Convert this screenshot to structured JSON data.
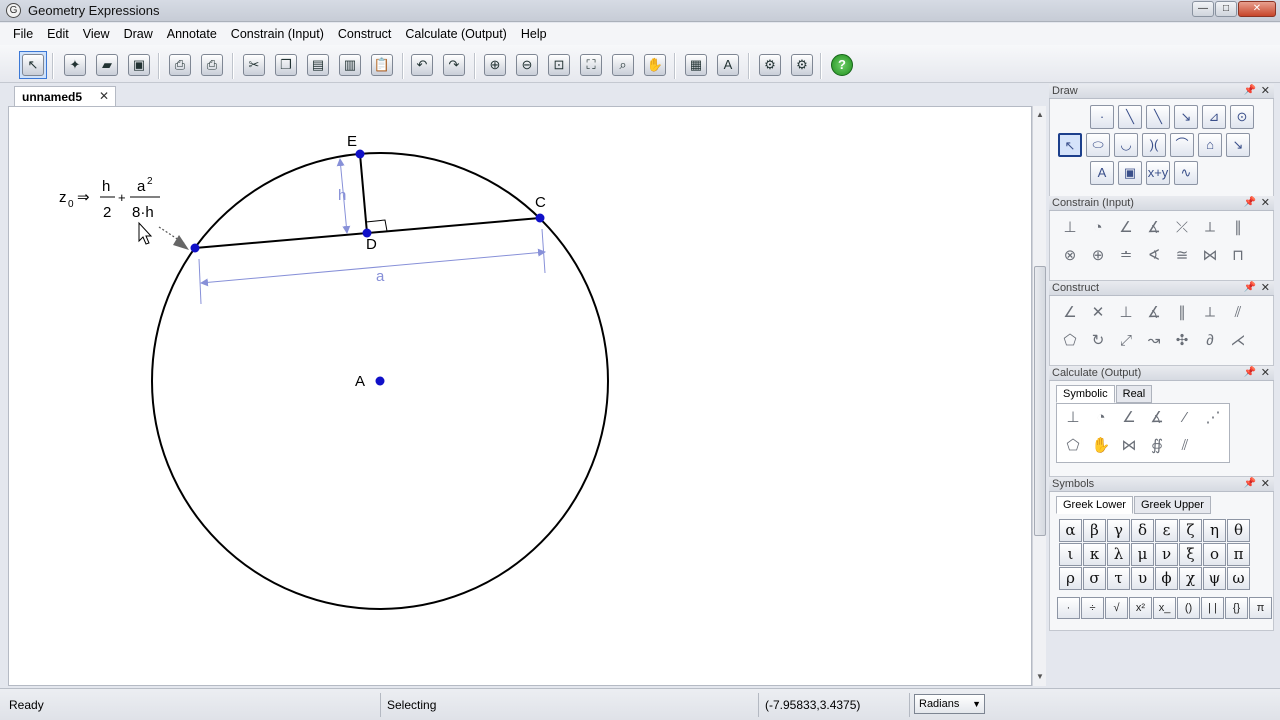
{
  "window": {
    "title": "Geometry Expressions",
    "min": "—",
    "max": "□",
    "close": "✕"
  },
  "menu": [
    "File",
    "Edit",
    "View",
    "Draw",
    "Annotate",
    "Constrain (Input)",
    "Construct",
    "Calculate (Output)",
    "Help"
  ],
  "document_tab": {
    "label": "unnamed5",
    "close": "✕"
  },
  "points": {
    "A": "A",
    "C": "C",
    "D": "D",
    "E": "E"
  },
  "dimensions": {
    "h": "h",
    "a": "a"
  },
  "formula": {
    "lhs": "z",
    "sub": "0",
    "arrow": "⇒",
    "num1": "h",
    "den1": "2",
    "plus": "+",
    "num2": "a",
    "sup": "2",
    "den2": "8·h"
  },
  "panels": {
    "draw": {
      "title": "Draw"
    },
    "constrain": {
      "title": "Constrain (Input)"
    },
    "construct": {
      "title": "Construct"
    },
    "calculate": {
      "title": "Calculate (Output)",
      "tabs": [
        "Symbolic",
        "Real"
      ]
    },
    "symbols": {
      "title": "Symbols",
      "tabs": [
        "Greek Lower",
        "Greek Upper"
      ],
      "greek": [
        "α",
        "β",
        "γ",
        "δ",
        "ε",
        "ζ",
        "η",
        "θ",
        "ι",
        "κ",
        "λ",
        "μ",
        "ν",
        "ξ",
        "ο",
        "π",
        "ρ",
        "σ",
        "τ",
        "υ",
        "ϕ",
        "χ",
        "ψ",
        "ω"
      ],
      "templates": [
        "·",
        "÷",
        "√",
        "x²",
        "x_",
        "()",
        "| |",
        "{}",
        "π"
      ]
    }
  },
  "status": {
    "left": "Ready",
    "mode": "Selecting",
    "coords": "(-7.95833,3.4375)",
    "angle_unit": "Radians"
  }
}
